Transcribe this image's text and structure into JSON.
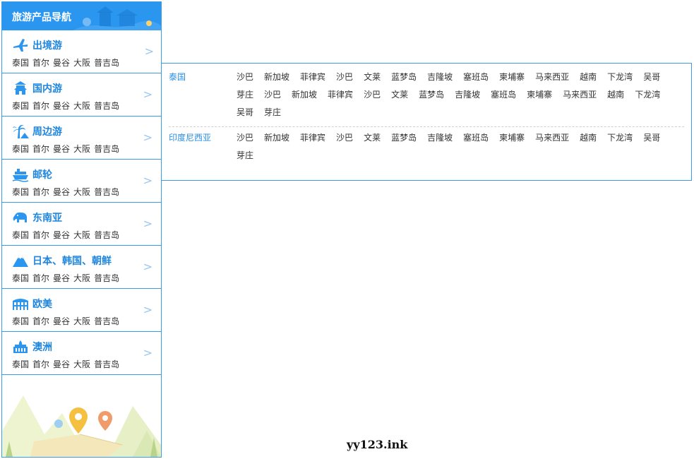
{
  "sidebar": {
    "title": "旅游产品导航",
    "categories": [
      {
        "name": "出境游",
        "icon": "plane-icon",
        "subs": [
          "泰国",
          "首尔",
          "曼谷",
          "大阪",
          "普吉岛"
        ],
        "arrow": ">"
      },
      {
        "name": "国内游",
        "icon": "temple-icon",
        "subs": [
          "泰国",
          "首尔",
          "曼谷",
          "大阪",
          "普吉岛"
        ],
        "arrow": ">"
      },
      {
        "name": "周边游",
        "icon": "palm-tree-icon",
        "subs": [
          "泰国",
          "首尔",
          "曼谷",
          "大阪",
          "普吉岛"
        ],
        "arrow": ">"
      },
      {
        "name": "邮轮",
        "icon": "cruise-ship-icon",
        "subs": [
          "泰国",
          "首尔",
          "曼谷",
          "大阪",
          "普吉岛"
        ],
        "arrow": ">"
      },
      {
        "name": "东南亚",
        "icon": "elephant-icon",
        "subs": [
          "泰国",
          "首尔",
          "曼谷",
          "大阪",
          "普吉岛"
        ],
        "arrow": ">"
      },
      {
        "name": "日本、韩国、朝鲜",
        "icon": "mount-fuji-icon",
        "subs": [
          "泰国",
          "首尔",
          "曼谷",
          "大阪",
          "普吉岛"
        ],
        "arrow": ">"
      },
      {
        "name": "欧美",
        "icon": "colosseum-icon",
        "subs": [
          "泰国",
          "首尔",
          "曼谷",
          "大阪",
          "普吉岛"
        ],
        "arrow": ">"
      },
      {
        "name": "澳洲",
        "icon": "opera-house-icon",
        "subs": [
          "泰国",
          "首尔",
          "曼谷",
          "大阪",
          "普吉岛"
        ],
        "arrow": ">"
      }
    ]
  },
  "flyout": {
    "regions": [
      {
        "name": "泰国",
        "links": [
          "沙巴",
          "新加坡",
          "菲律宾",
          "沙巴",
          "文莱",
          "蓝梦岛",
          "吉隆坡",
          "塞班岛",
          "柬埔寨",
          "马来西亚",
          "越南",
          "下龙湾",
          "吴哥",
          "芽庄",
          "沙巴",
          "新加坡",
          "菲律宾",
          "沙巴",
          "文莱",
          "蓝梦岛",
          "吉隆坡",
          "塞班岛",
          "柬埔寨",
          "马来西亚",
          "越南",
          "下龙湾",
          "吴哥",
          "芽庄"
        ]
      },
      {
        "name": "印度尼西亚",
        "links": [
          "沙巴",
          "新加坡",
          "菲律宾",
          "沙巴",
          "文莱",
          "蓝梦岛",
          "吉隆坡",
          "塞班岛",
          "柬埔寨",
          "马来西亚",
          "越南",
          "下龙湾",
          "吴哥",
          "芽庄"
        ]
      }
    ]
  },
  "watermark": "yy123.ink",
  "colors": {
    "accent": "#2b96f0",
    "border": "#3a9be8",
    "link": "#1f86e0"
  }
}
